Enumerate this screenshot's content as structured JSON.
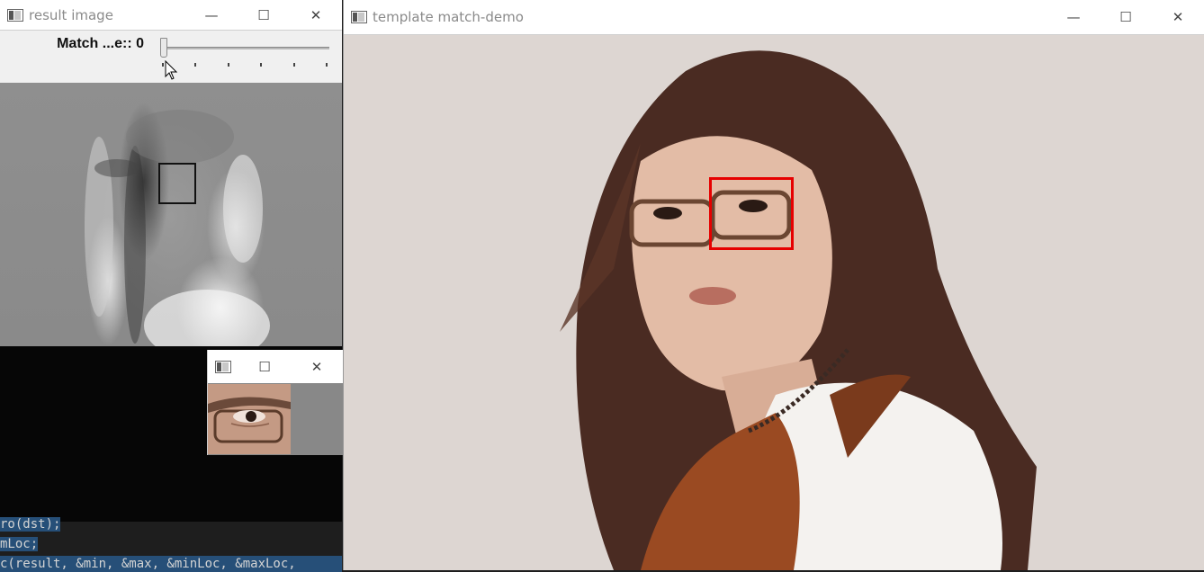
{
  "result_window": {
    "title": "result image",
    "trackbar": {
      "label": "Match ...e:: 0",
      "value": 0,
      "ticks": 6
    }
  },
  "template_window": {
    "title": ""
  },
  "main_window": {
    "title": "template match-demo"
  },
  "window_controls": {
    "minimize": "—",
    "maximize": "☐",
    "close": "✕"
  },
  "code_lines": [
    "ro(dst);",
    "mLoc;",
    "c(result, &min, &max, &minLoc, &maxLoc,"
  ],
  "colors": {
    "match_rect": "#e60000",
    "selection": "#264f78"
  }
}
